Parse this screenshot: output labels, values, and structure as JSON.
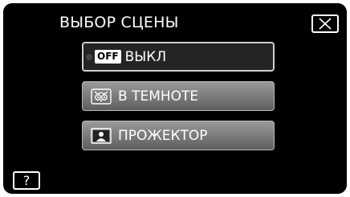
{
  "header": {
    "title": "ВЫБОР СЦЕНЫ",
    "close_icon": "close-icon"
  },
  "scene_options": [
    {
      "label": "ВЫКЛ",
      "icon": "off-icon",
      "icon_text": "OFF",
      "selected": true
    },
    {
      "label": "В ТЕМНОТЕ",
      "icon": "owl-night-icon",
      "selected": false
    },
    {
      "label": "ПРОЖЕКТОР",
      "icon": "spotlight-icon",
      "selected": false
    }
  ],
  "footer": {
    "help_label": "?"
  },
  "colors": {
    "background": "#000000",
    "selected_button": "#242424",
    "button_gradient_top": "#9a9a9a",
    "button_gradient_bottom": "#5e5e5e",
    "text": "#ffffff"
  }
}
